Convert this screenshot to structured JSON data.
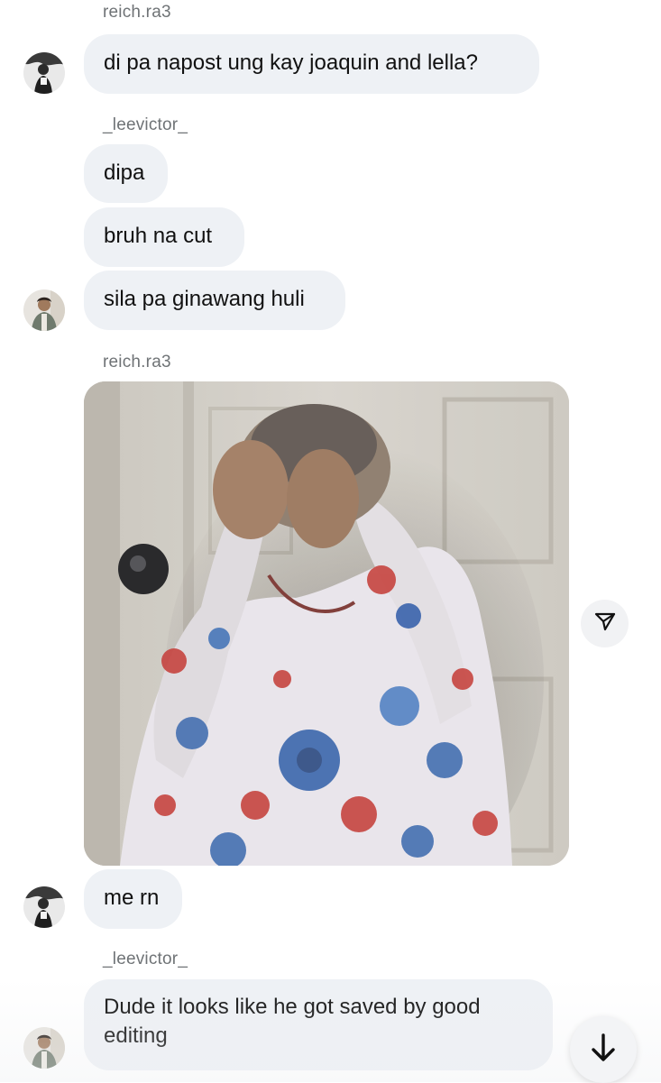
{
  "messages": {
    "m1": {
      "sender": "reich.ra3",
      "text": "di pa napost ung kay joaquin and lella?"
    },
    "m2": {
      "sender": "_leevictor_",
      "text1": "dipa",
      "text2": "bruh na cut",
      "text3": "sila pa ginawang huli"
    },
    "m3": {
      "sender": "reich.ra3",
      "caption": "me rn"
    },
    "m4": {
      "sender": "_leevictor_",
      "text": "Dude it looks like he got saved by good editing"
    }
  },
  "icons": {
    "share": "paper-plane-icon",
    "scroll": "arrow-down-icon"
  },
  "colors": {
    "bubble": "#eef1f5",
    "sender_text": "#6f7376",
    "message_text": "#111111",
    "background": "#ffffff"
  }
}
